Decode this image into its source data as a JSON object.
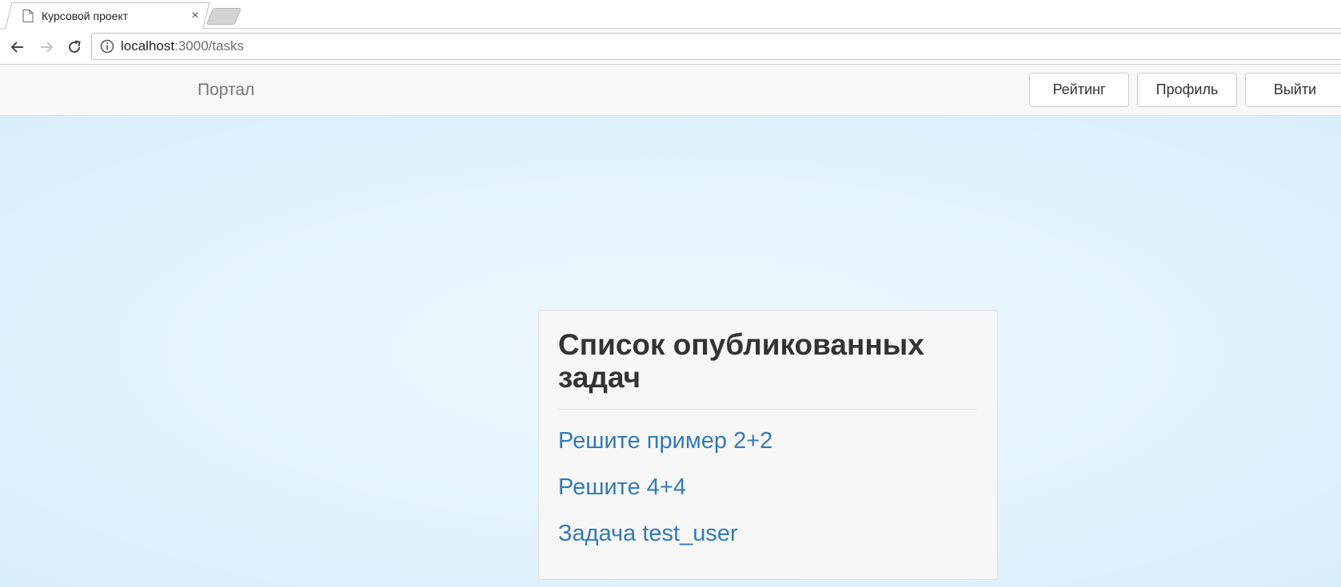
{
  "browser": {
    "tab": {
      "title": "Курсовой проект",
      "favicon": "page-icon",
      "close": "×"
    },
    "address": {
      "host": "localhost",
      "rest": ":3000/tasks"
    }
  },
  "site": {
    "brand": "Портал",
    "nav": {
      "rating": "Рейтинг",
      "profile": "Профиль",
      "logout": "Выйти"
    }
  },
  "main": {
    "title": "Список опубликованных задач",
    "tasks": [
      {
        "label": "Решите пример 2+2"
      },
      {
        "label": "Решите 4+4"
      },
      {
        "label": "Задача test_user"
      }
    ]
  },
  "colors": {
    "link": "#337ab7",
    "background": "#e3f3fd",
    "panel": "#f7f7f7"
  }
}
